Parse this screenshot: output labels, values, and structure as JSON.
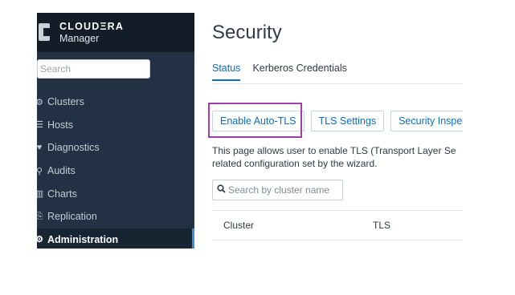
{
  "brand": {
    "name": "CLOUDΞRA",
    "product": "Manager"
  },
  "sidebar": {
    "search_placeholder": "Search",
    "items": [
      {
        "icon": "clusters-icon",
        "glyph": "⚙",
        "label": "Clusters"
      },
      {
        "icon": "hosts-icon",
        "glyph": "☰",
        "label": "Hosts"
      },
      {
        "icon": "diagnostics-icon",
        "glyph": "♥",
        "label": "Diagnostics"
      },
      {
        "icon": "audits-icon",
        "glyph": "⚲",
        "label": "Audits"
      },
      {
        "icon": "charts-icon",
        "glyph": "▥",
        "label": "Charts"
      },
      {
        "icon": "replication-icon",
        "glyph": "⎘",
        "label": "Replication"
      },
      {
        "icon": "administration-icon",
        "glyph": "⚙",
        "label": "Administration",
        "active": true
      }
    ]
  },
  "page": {
    "title": "Security"
  },
  "tabs": [
    {
      "label": "Status",
      "active": true
    },
    {
      "label": "Kerberos Credentials",
      "active": false
    }
  ],
  "actions": {
    "enable_auto_tls": "Enable Auto-TLS",
    "tls_settings": "TLS Settings",
    "security_inspector": "Security Inspect"
  },
  "description": {
    "line1": "This page allows user to enable TLS (Transport Layer Se",
    "line2": "related configuration set by the wizard."
  },
  "cluster_search": {
    "placeholder": "Search by cluster name",
    "icon": "search-icon"
  },
  "table": {
    "headers": [
      "Cluster",
      "TLS"
    ]
  },
  "colors": {
    "sidebar_bg": "#223244",
    "brand_bg": "#121d29",
    "accent_blue": "#0c6ec3",
    "highlight": "#a23cac"
  }
}
